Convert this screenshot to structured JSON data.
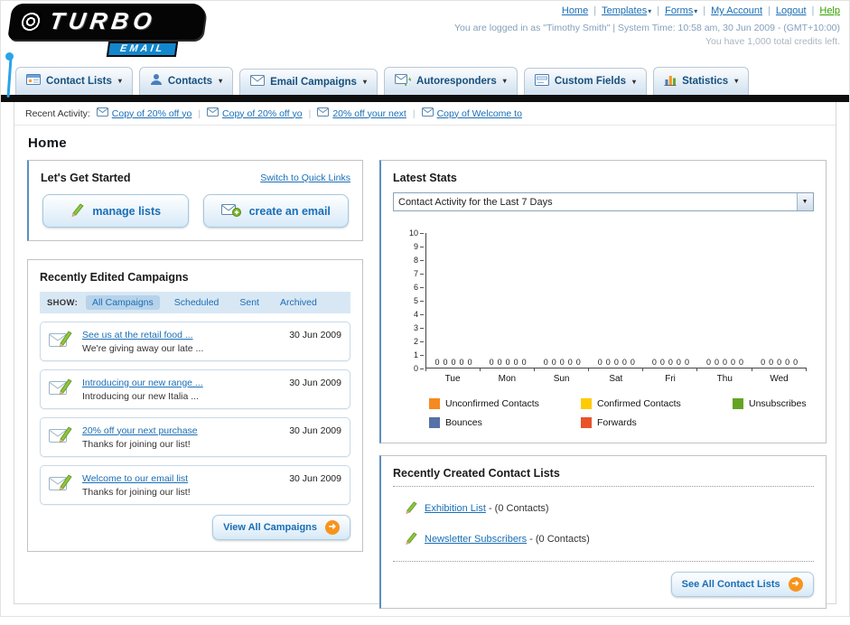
{
  "header": {
    "logo": {
      "title": "TURBO",
      "subtitle": "EMAIL"
    },
    "links": [
      {
        "label": "Home",
        "color": "#1a6eb5"
      },
      {
        "label": "Templates",
        "color": "#1a6eb5",
        "dropdown": true
      },
      {
        "label": "Forms",
        "color": "#1a6eb5",
        "dropdown": true
      },
      {
        "label": "My Account",
        "color": "#1a6eb5"
      },
      {
        "label": "Logout",
        "color": "#1a6eb5"
      },
      {
        "label": "Help",
        "color": "#33a000"
      }
    ],
    "login_info": "You are logged in as \"Timothy Smith\" | System Time: 10:58 am, 30 Jun 2009 - (GMT+10:00)",
    "credits": "You have 1,000 total credits left."
  },
  "nav": {
    "items": [
      {
        "label": "Contact Lists"
      },
      {
        "label": "Contacts"
      },
      {
        "label": "Email Campaigns"
      },
      {
        "label": "Autoresponders"
      },
      {
        "label": "Custom Fields"
      },
      {
        "label": "Statistics"
      }
    ]
  },
  "recent_activity": {
    "label": "Recent Activity:",
    "items": [
      {
        "label": "Copy of 20% off yo"
      },
      {
        "label": "Copy of 20% off yo"
      },
      {
        "label": "20% off your next"
      },
      {
        "label": "Copy of Welcome to"
      }
    ]
  },
  "page": {
    "title": "Home"
  },
  "get_started": {
    "title": "Let's Get Started",
    "switch_link": "Switch to Quick Links",
    "manage_lists_button": "manage lists",
    "create_email_button": "create an email"
  },
  "campaigns": {
    "title": "Recently Edited Campaigns",
    "show_label": "SHOW:",
    "tabs": [
      {
        "label": "All Campaigns",
        "active": true
      },
      {
        "label": "Scheduled"
      },
      {
        "label": "Sent"
      },
      {
        "label": "Archived"
      }
    ],
    "items": [
      {
        "title": "See us at the retail food ...",
        "subtitle": "We're giving away our late ...",
        "date": "30 Jun 2009"
      },
      {
        "title": "Introducing our new range ...",
        "subtitle": "Introducing our new Italia ...",
        "date": "30 Jun 2009"
      },
      {
        "title": "20% off your next purchase",
        "subtitle": "Thanks for joining our list!",
        "date": "30 Jun 2009"
      },
      {
        "title": "Welcome to our email list",
        "subtitle": "Thanks for joining our list!",
        "date": "30 Jun 2009"
      }
    ],
    "view_all_button": "View All Campaigns"
  },
  "stats": {
    "title": "Latest Stats",
    "selected_filter": "Contact Activity for the Last 7 Days",
    "chart_data": {
      "type": "bar",
      "title": "Contact Activity for the Last 7 Days",
      "categories": [
        "Tue",
        "Mon",
        "Sun",
        "Sat",
        "Fri",
        "Thu",
        "Wed"
      ],
      "series": [
        {
          "name": "Unconfirmed Contacts",
          "color": "#f6891f",
          "values": [
            0,
            0,
            0,
            0,
            0,
            0,
            0
          ]
        },
        {
          "name": "Confirmed Contacts",
          "color": "#fecb00",
          "values": [
            0,
            0,
            0,
            0,
            0,
            0,
            0
          ]
        },
        {
          "name": "Unsubscribes",
          "color": "#64a424",
          "values": [
            0,
            0,
            0,
            0,
            0,
            0,
            0
          ]
        },
        {
          "name": "Bounces",
          "color": "#5571a7",
          "values": [
            0,
            0,
            0,
            0,
            0,
            0,
            0
          ]
        },
        {
          "name": "Forwards",
          "color": "#e8532c",
          "values": [
            0,
            0,
            0,
            0,
            0,
            0,
            0
          ]
        }
      ],
      "xlabel": "",
      "ylabel": "",
      "ylim": [
        0,
        10
      ],
      "yticks": [
        10,
        9,
        8,
        7,
        6,
        5,
        4,
        3,
        2,
        1,
        0
      ],
      "grid": false,
      "legend_position": "bottom",
      "bar_value_labels_shown": true
    }
  },
  "contact_lists": {
    "title": "Recently Created Contact Lists",
    "items": [
      {
        "name": "Exhibition List",
        "detail": "- (0 Contacts)"
      },
      {
        "name": "Newsletter Subscribers",
        "detail": "- (0 Contacts)"
      }
    ],
    "see_all_button": "See All Contact Lists"
  },
  "icons": {
    "dropdown_arrow": "▾",
    "select_arrow": "▼",
    "forward_arrow": "➜",
    "separator": "|"
  }
}
